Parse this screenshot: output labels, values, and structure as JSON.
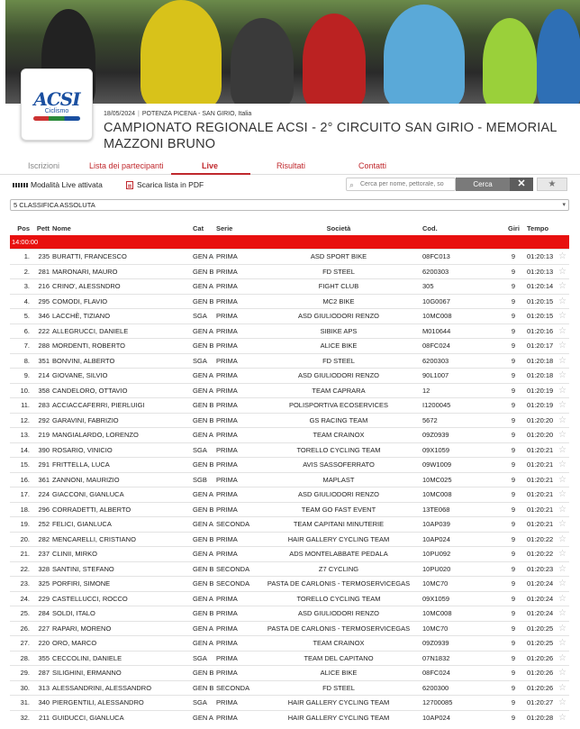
{
  "event": {
    "date": "18/05/2024",
    "location": "POTENZA PICENA - SAN GIRIO, Italia",
    "title": "CAMPIONATO REGIONALE ACSI - 2° CIRCUITO SAN GIRIO - MEMORIAL MAZZONI BRUNO",
    "logo_text": "ACSI",
    "logo_sub": "Ciclismo"
  },
  "tabs": [
    {
      "label": "Iscrizioni"
    },
    {
      "label": "Lista dei partecipanti"
    },
    {
      "label": "Live"
    },
    {
      "label": "Risultati"
    },
    {
      "label": "Contatti"
    }
  ],
  "toolbar": {
    "live_label": "Modalità Live attivata",
    "pdf_label": "Scarica lista in PDF",
    "search_placeholder": "Cerca per nome, pettorale, so",
    "search_button": "Cerca",
    "clear_button": "✕",
    "star_button": "★"
  },
  "ranking_select": "5 CLASSIFICA ASSOLUTA",
  "columns": {
    "pos": "Pos",
    "pett": "Pett",
    "name": "Nome",
    "cat": "Cat",
    "serie": "Serie",
    "societa": "Società",
    "cod": "Cod.",
    "giri": "Giri",
    "tempo": "Tempo"
  },
  "group_label": "14:00:00",
  "rows": [
    {
      "pos": "1.",
      "pett": "235",
      "name": "BURATTI, FRANCESCO",
      "cat": "GEN A",
      "serie": "PRIMA",
      "societa": "ASD SPORT BIKE",
      "cod": "08FC013",
      "giri": "9",
      "tempo": "01:20:13"
    },
    {
      "pos": "2.",
      "pett": "281",
      "name": "MARONARI, MAURO",
      "cat": "GEN B",
      "serie": "PRIMA",
      "societa": "FD STEEL",
      "cod": "6200303",
      "giri": "9",
      "tempo": "01:20:13"
    },
    {
      "pos": "3.",
      "pett": "216",
      "name": "CRINO', ALESSNDRO",
      "cat": "GEN A",
      "serie": "PRIMA",
      "societa": "FIGHT CLUB",
      "cod": "305",
      "giri": "9",
      "tempo": "01:20:14"
    },
    {
      "pos": "4.",
      "pett": "295",
      "name": "COMODI, FLAVIO",
      "cat": "GEN B",
      "serie": "PRIMA",
      "societa": "MC2 BIKE",
      "cod": "10G0067",
      "giri": "9",
      "tempo": "01:20:15"
    },
    {
      "pos": "5.",
      "pett": "346",
      "name": "LACCHÈ, TIZIANO",
      "cat": "SGA",
      "serie": "PRIMA",
      "societa": "ASD GIULIODORI RENZO",
      "cod": "10MC008",
      "giri": "9",
      "tempo": "01:20:15"
    },
    {
      "pos": "6.",
      "pett": "222",
      "name": "ALLEGRUCCI, DANIELE",
      "cat": "GEN A",
      "serie": "PRIMA",
      "societa": "SIBIKE APS",
      "cod": "M010644",
      "giri": "9",
      "tempo": "01:20:16"
    },
    {
      "pos": "7.",
      "pett": "288",
      "name": "MORDENTI, ROBERTO",
      "cat": "GEN B",
      "serie": "PRIMA",
      "societa": "ALICE BIKE",
      "cod": "08FC024",
      "giri": "9",
      "tempo": "01:20:17"
    },
    {
      "pos": "8.",
      "pett": "351",
      "name": "BONVINI, ALBERTO",
      "cat": "SGA",
      "serie": "PRIMA",
      "societa": "FD STEEL",
      "cod": "6200303",
      "giri": "9",
      "tempo": "01:20:18"
    },
    {
      "pos": "9.",
      "pett": "214",
      "name": "GIOVANE, SILVIO",
      "cat": "GEN A",
      "serie": "PRIMA",
      "societa": "ASD GIULIODORI RENZO",
      "cod": "90L1007",
      "giri": "9",
      "tempo": "01:20:18"
    },
    {
      "pos": "10.",
      "pett": "358",
      "name": "CANDELORO, OTTAVIO",
      "cat": "GEN A",
      "serie": "PRIMA",
      "societa": "TEAM CAPRARA",
      "cod": "12",
      "giri": "9",
      "tempo": "01:20:19"
    },
    {
      "pos": "11.",
      "pett": "283",
      "name": "ACCIACCAFERRI, PIERLUIGI",
      "cat": "GEN B",
      "serie": "PRIMA",
      "societa": "POLISPORTIVA ECOSERVICES",
      "cod": "I1200045",
      "giri": "9",
      "tempo": "01:20:19"
    },
    {
      "pos": "12.",
      "pett": "292",
      "name": "GARAVINI, FABRIZIO",
      "cat": "GEN B",
      "serie": "PRIMA",
      "societa": "GS RACING TEAM",
      "cod": "5672",
      "giri": "9",
      "tempo": "01:20:20"
    },
    {
      "pos": "13.",
      "pett": "219",
      "name": "MANGIALARDO, LORENZO",
      "cat": "GEN A",
      "serie": "PRIMA",
      "societa": "TEAM CRAINOX",
      "cod": "09Z0939",
      "giri": "9",
      "tempo": "01:20:20"
    },
    {
      "pos": "14.",
      "pett": "390",
      "name": "ROSARIO, VINICIO",
      "cat": "SGA",
      "serie": "PRIMA",
      "societa": "TORELLO CYCLING TEAM",
      "cod": "09X1059",
      "giri": "9",
      "tempo": "01:20:21"
    },
    {
      "pos": "15.",
      "pett": "291",
      "name": "FRITTELLA, LUCA",
      "cat": "GEN B",
      "serie": "PRIMA",
      "societa": "AVIS SASSOFERRATO",
      "cod": "09W1009",
      "giri": "9",
      "tempo": "01:20:21"
    },
    {
      "pos": "16.",
      "pett": "361",
      "name": "ZANNONI, MAURIZIO",
      "cat": "SGB",
      "serie": "PRIMA",
      "societa": "MAPLAST",
      "cod": "10MC025",
      "giri": "9",
      "tempo": "01:20:21"
    },
    {
      "pos": "17.",
      "pett": "224",
      "name": "GIACCONI, GIANLUCA",
      "cat": "GEN A",
      "serie": "PRIMA",
      "societa": "ASD GIULIODORI RENZO",
      "cod": "10MC008",
      "giri": "9",
      "tempo": "01:20:21"
    },
    {
      "pos": "18.",
      "pett": "296",
      "name": "CORRADETTI, ALBERTO",
      "cat": "GEN B",
      "serie": "PRIMA",
      "societa": "TEAM GO FAST EVENT",
      "cod": "13TE068",
      "giri": "9",
      "tempo": "01:20:21"
    },
    {
      "pos": "19.",
      "pett": "252",
      "name": "FELICI, GIANLUCA",
      "cat": "GEN A",
      "serie": "SECONDA",
      "societa": "TEAM CAPITANI MINUTERIE",
      "cod": "10AP039",
      "giri": "9",
      "tempo": "01:20:21"
    },
    {
      "pos": "20.",
      "pett": "282",
      "name": "MENCARELLI, CRISTIANO",
      "cat": "GEN B",
      "serie": "PRIMA",
      "societa": "HAIR GALLERY CYCLING TEAM",
      "cod": "10AP024",
      "giri": "9",
      "tempo": "01:20:22"
    },
    {
      "pos": "21.",
      "pett": "237",
      "name": "CLINII, MIRKO",
      "cat": "GEN A",
      "serie": "PRIMA",
      "societa": "ADS MONTELABBATE PEDALA",
      "cod": "10PU092",
      "giri": "9",
      "tempo": "01:20:22"
    },
    {
      "pos": "22.",
      "pett": "328",
      "name": "SANTINI, STEFANO",
      "cat": "GEN B",
      "serie": "SECONDA",
      "societa": "Z7 CYCLING",
      "cod": "10PU020",
      "giri": "9",
      "tempo": "01:20:23"
    },
    {
      "pos": "23.",
      "pett": "325",
      "name": "PORFIRI, SIMONE",
      "cat": "GEN B",
      "serie": "SECONDA",
      "societa": "PASTA DE CARLONIS - TERMOSERVICEGAS",
      "cod": "10MC70",
      "giri": "9",
      "tempo": "01:20:24"
    },
    {
      "pos": "24.",
      "pett": "229",
      "name": "CASTELLUCCI, ROCCO",
      "cat": "GEN A",
      "serie": "PRIMA",
      "societa": "TORELLO CYCLING TEAM",
      "cod": "09X1059",
      "giri": "9",
      "tempo": "01:20:24"
    },
    {
      "pos": "25.",
      "pett": "284",
      "name": "SOLDI, ITALO",
      "cat": "GEN B",
      "serie": "PRIMA",
      "societa": "ASD GIULIODORI RENZO",
      "cod": "10MC008",
      "giri": "9",
      "tempo": "01:20:24"
    },
    {
      "pos": "26.",
      "pett": "227",
      "name": "RAPARI, MORENO",
      "cat": "GEN A",
      "serie": "PRIMA",
      "societa": "PASTA DE CARLONIS - TERMOSERVICEGAS",
      "cod": "10MC70",
      "giri": "9",
      "tempo": "01:20:25"
    },
    {
      "pos": "27.",
      "pett": "220",
      "name": "ORO, MARCO",
      "cat": "GEN A",
      "serie": "PRIMA",
      "societa": "TEAM CRAINOX",
      "cod": "09Z0939",
      "giri": "9",
      "tempo": "01:20:25"
    },
    {
      "pos": "28.",
      "pett": "355",
      "name": "CECCOLINI, DANIELE",
      "cat": "SGA",
      "serie": "PRIMA",
      "societa": "TEAM DEL CAPITANO",
      "cod": "07N1832",
      "giri": "9",
      "tempo": "01:20:26"
    },
    {
      "pos": "29.",
      "pett": "287",
      "name": "SILIGHINI, ERMANNO",
      "cat": "GEN B",
      "serie": "PRIMA",
      "societa": "ALICE BIKE",
      "cod": "08FC024",
      "giri": "9",
      "tempo": "01:20:26"
    },
    {
      "pos": "30.",
      "pett": "313",
      "name": "ALESSANDRINI, ALESSANDRO",
      "cat": "GEN B",
      "serie": "SECONDA",
      "societa": "FD STEEL",
      "cod": "6200300",
      "giri": "9",
      "tempo": "01:20:26"
    },
    {
      "pos": "31.",
      "pett": "340",
      "name": "PIERGENTILI, ALESSANDRO",
      "cat": "SGA",
      "serie": "PRIMA",
      "societa": "HAIR GALLERY CYCLING TEAM",
      "cod": "12700085",
      "giri": "9",
      "tempo": "01:20:27"
    },
    {
      "pos": "32.",
      "pett": "211",
      "name": "GUIDUCCI, GIANLUCA",
      "cat": "GEN A",
      "serie": "PRIMA",
      "societa": "HAIR GALLERY CYCLING TEAM",
      "cod": "10AP024",
      "giri": "9",
      "tempo": "01:20:28"
    }
  ],
  "colors": {
    "accent": "#c0282d",
    "group_bar": "#e8100f"
  },
  "icons": {
    "favorite": "star-outline-icon",
    "pdf": "pdf-file-icon",
    "search": "search-icon"
  }
}
